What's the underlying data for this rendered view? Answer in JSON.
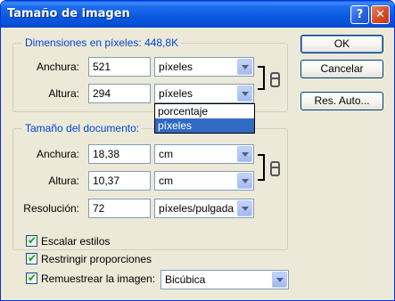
{
  "dialog": {
    "title": "Tamaño de imagen",
    "help_glyph": "?",
    "close_glyph": "✕"
  },
  "pixel_dimensions": {
    "legend": "Dimensiones en píxeles: 448,8K",
    "width_label": "Anchura:",
    "width_value": "521",
    "width_unit": "píxeles",
    "height_label": "Altura:",
    "height_value": "294",
    "height_unit": "píxeles"
  },
  "unit_dropdown": {
    "options": [
      "porcentaje",
      "píxeles"
    ],
    "selected": "píxeles"
  },
  "document_size": {
    "legend": "Tamaño del documento:",
    "width_label": "Anchura:",
    "width_value": "18,38",
    "width_unit": "cm",
    "height_label": "Altura:",
    "height_value": "10,37",
    "height_unit": "cm",
    "resolution_label": "Resolución:",
    "resolution_value": "72",
    "resolution_unit": "píxeles/pulgada"
  },
  "options": {
    "scale_styles": {
      "label": "Escalar estilos",
      "checked": true
    },
    "constrain_proportions": {
      "label": "Restringir proporciones",
      "checked": true
    },
    "resample": {
      "label": "Remuestrear la imagen:",
      "checked": true,
      "method": "Bicúbica"
    }
  },
  "buttons": {
    "ok": "OK",
    "cancel": "Cancelar",
    "auto": "Res. Auto..."
  },
  "icons": [
    "help-icon",
    "close-icon",
    "chain-link-icon",
    "chevron-down-icon",
    "checkmark-icon"
  ]
}
